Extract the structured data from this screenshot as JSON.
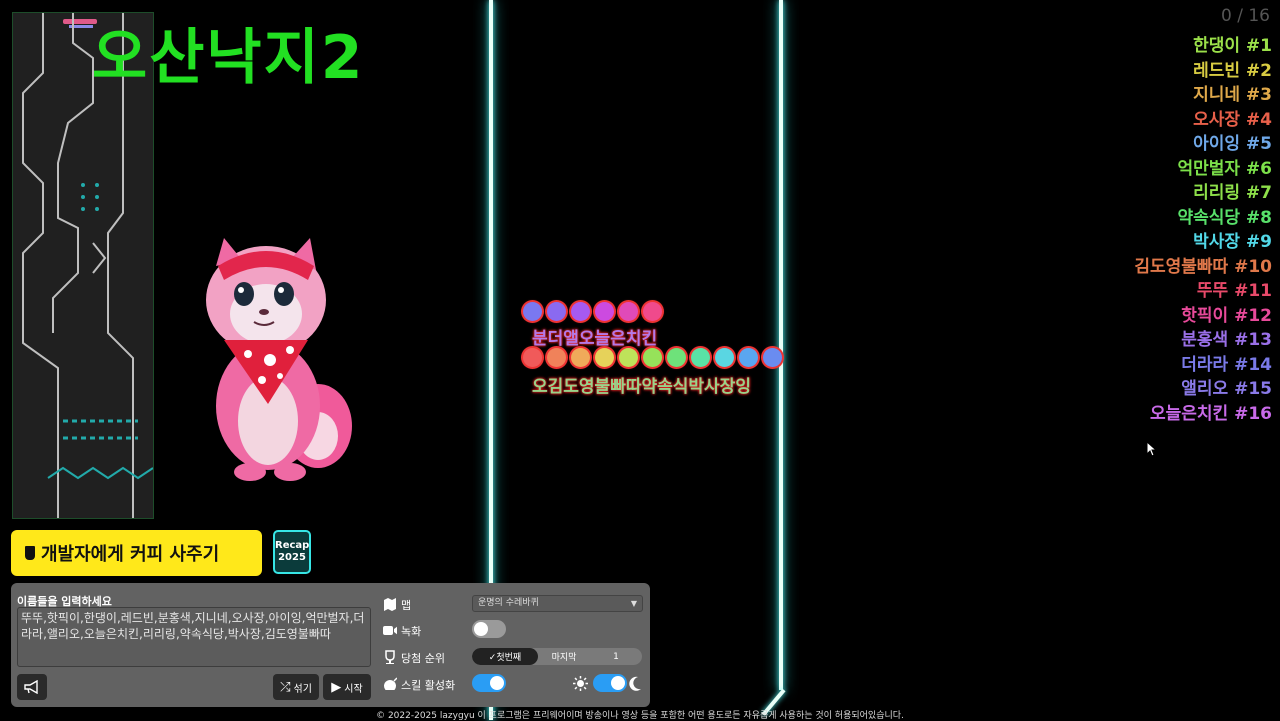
{
  "title": "오산낙지2",
  "counter": "0 / 16",
  "ranking": [
    {
      "name": "한댕이",
      "rank": "#1",
      "color": "#9be04a"
    },
    {
      "name": "레드빈",
      "rank": "#2",
      "color": "#d8cc42"
    },
    {
      "name": "지니네",
      "rank": "#3",
      "color": "#e0a94a"
    },
    {
      "name": "오사장",
      "rank": "#4",
      "color": "#e8604a"
    },
    {
      "name": "아이잉",
      "rank": "#5",
      "color": "#6fa8e8"
    },
    {
      "name": "억만벌자",
      "rank": "#6",
      "color": "#7ce04a"
    },
    {
      "name": "리리링",
      "rank": "#7",
      "color": "#8ee04a"
    },
    {
      "name": "약속식당",
      "rank": "#8",
      "color": "#58e06a"
    },
    {
      "name": "박사장",
      "rank": "#9",
      "color": "#52d8e8"
    },
    {
      "name": "김도영불빠따",
      "rank": "#10",
      "color": "#e0784a"
    },
    {
      "name": "뚜뚜",
      "rank": "#11",
      "color": "#e84a6a"
    },
    {
      "name": "핫픽이",
      "rank": "#12",
      "color": "#e84a9a"
    },
    {
      "name": "분홍색",
      "rank": "#13",
      "color": "#9a70e8"
    },
    {
      "name": "더라라",
      "rank": "#14",
      "color": "#7a7ae8"
    },
    {
      "name": "앨리오",
      "rank": "#15",
      "color": "#8a7ae8"
    },
    {
      "name": "오늘은치킨",
      "rank": "#16",
      "color": "#c86ae8"
    }
  ],
  "marbles": {
    "row1_colors": [
      "#7a78f0",
      "#8a6af0",
      "#a65af0",
      "#cc4ae0",
      "#e04ab8",
      "#f04a8c"
    ],
    "row1_label": "분더앨오늘은치킨",
    "row2_colors": [
      "#f05a5a",
      "#f0825a",
      "#f0aa5a",
      "#e6d25a",
      "#bee25a",
      "#96e25a",
      "#6ee27a",
      "#5ae2a6",
      "#5ad6e2",
      "#5aa6f0",
      "#6a8cf0"
    ],
    "row2_label": "오김도영불빠따약속식박사장잉"
  },
  "coffee_button": "개발자에게 커피 사주기",
  "recap": {
    "line1": "Recap",
    "line2": "2025"
  },
  "controls": {
    "names_label": "이름들을 입력하세요",
    "names_value": "뚜뚜,핫픽이,한댕이,레드빈,분홍색,지니네,오사장,아이잉,억만벌자,더라라,앨리오,오늘은치킨,리리링,약속식당,박사장,김도영불빠따",
    "shuffle": "섞기",
    "start": "시작",
    "map_label": "맵",
    "map_value": "운명의 수레바퀴",
    "record_label": "녹화",
    "record_on": false,
    "winner_label": "당첨 순위",
    "winner_first": "✓첫번째",
    "winner_last": "마지막",
    "winner_count": "1",
    "skill_label": "스킬 활성화",
    "skill_on": true,
    "theme_dark": true
  },
  "footer": "© 2022-2025 lazygyu 이 프로그램은 프리웨어이며 방송이나 영상 등을 포함한 어떤 용도로든 자유롭게 사용하는 것이 허용되어있습니다."
}
